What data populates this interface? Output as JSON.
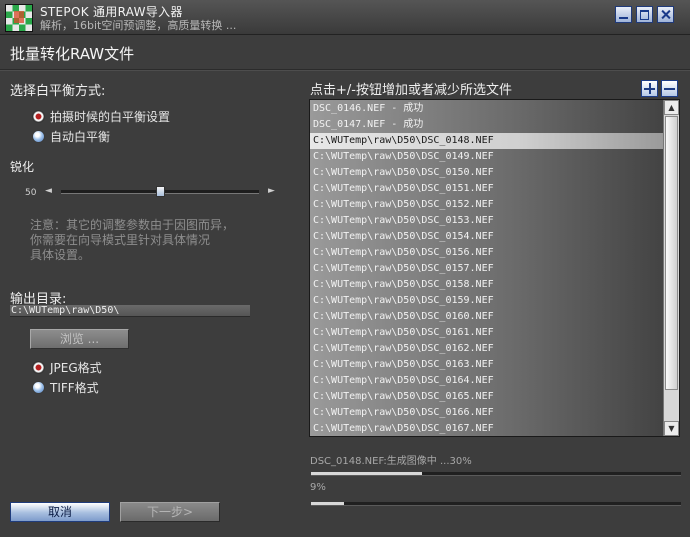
{
  "window": {
    "title": "STEPOK 通用RAW导入器",
    "subtitle": "解析，16bit空间预调整，高质量转换 ..."
  },
  "page_title": "批量转化RAW文件",
  "white_balance": {
    "label": "选择白平衡方式:",
    "options": [
      {
        "label": "拍摄时候的白平衡设置",
        "selected": true
      },
      {
        "label": "自动白平衡",
        "selected": false
      }
    ]
  },
  "sharpen": {
    "label": "锐化",
    "value": "50",
    "fraction": 0.5,
    "left_arrow": "◄",
    "right_arrow": "►"
  },
  "note": "注意：其它的调整参数由于因图而异，\n你需要在向导模式里针对具体情况\n具体设置。",
  "output": {
    "label": "输出目录:",
    "path": "C:\\WUTemp\\raw\\D50\\",
    "browse_label": "浏览 ...",
    "formats": [
      {
        "label": "JPEG格式",
        "selected": true
      },
      {
        "label": "TIFF格式",
        "selected": false
      }
    ]
  },
  "file_list": {
    "hint": "点击+/-按钮增加或者减少所选文件",
    "add_label": "+",
    "remove_label": "−",
    "items": [
      {
        "text": "DSC_0146.NEF - 成功",
        "selected": false
      },
      {
        "text": "DSC_0147.NEF - 成功",
        "selected": false
      },
      {
        "text": "C:\\WUTemp\\raw\\D50\\DSC_0148.NEF",
        "selected": true
      },
      {
        "text": "C:\\WUTemp\\raw\\D50\\DSC_0149.NEF",
        "selected": false
      },
      {
        "text": "C:\\WUTemp\\raw\\D50\\DSC_0150.NEF",
        "selected": false
      },
      {
        "text": "C:\\WUTemp\\raw\\D50\\DSC_0151.NEF",
        "selected": false
      },
      {
        "text": "C:\\WUTemp\\raw\\D50\\DSC_0152.NEF",
        "selected": false
      },
      {
        "text": "C:\\WUTemp\\raw\\D50\\DSC_0153.NEF",
        "selected": false
      },
      {
        "text": "C:\\WUTemp\\raw\\D50\\DSC_0154.NEF",
        "selected": false
      },
      {
        "text": "C:\\WUTemp\\raw\\D50\\DSC_0156.NEF",
        "selected": false
      },
      {
        "text": "C:\\WUTemp\\raw\\D50\\DSC_0157.NEF",
        "selected": false
      },
      {
        "text": "C:\\WUTemp\\raw\\D50\\DSC_0158.NEF",
        "selected": false
      },
      {
        "text": "C:\\WUTemp\\raw\\D50\\DSC_0159.NEF",
        "selected": false
      },
      {
        "text": "C:\\WUTemp\\raw\\D50\\DSC_0160.NEF",
        "selected": false
      },
      {
        "text": "C:\\WUTemp\\raw\\D50\\DSC_0161.NEF",
        "selected": false
      },
      {
        "text": "C:\\WUTemp\\raw\\D50\\DSC_0162.NEF",
        "selected": false
      },
      {
        "text": "C:\\WUTemp\\raw\\D50\\DSC_0163.NEF",
        "selected": false
      },
      {
        "text": "C:\\WUTemp\\raw\\D50\\DSC_0164.NEF",
        "selected": false
      },
      {
        "text": "C:\\WUTemp\\raw\\D50\\DSC_0165.NEF",
        "selected": false
      },
      {
        "text": "C:\\WUTemp\\raw\\D50\\DSC_0166.NEF",
        "selected": false
      },
      {
        "text": "C:\\WUTemp\\raw\\D50\\DSC_0167.NEF",
        "selected": false
      }
    ],
    "scroll_up": "▲",
    "scroll_down": "▼"
  },
  "progress": {
    "file_status": "DSC_0148.NEF:生成图像中 ...30%",
    "file_fraction": 0.3,
    "total_status": "9%",
    "total_fraction": 0.09
  },
  "buttons": {
    "cancel": "取消",
    "next": "下一步>"
  },
  "colors": {
    "background": "#3d3d3d",
    "accent_blue": "#1f3c7c",
    "radio_selected": "#b52020"
  },
  "icons": {
    "app": "stepok-logo-icon",
    "minimize": "minimize-icon",
    "maximize": "maximize-icon",
    "close": "close-icon",
    "add": "plus-icon",
    "remove": "minus-icon"
  }
}
